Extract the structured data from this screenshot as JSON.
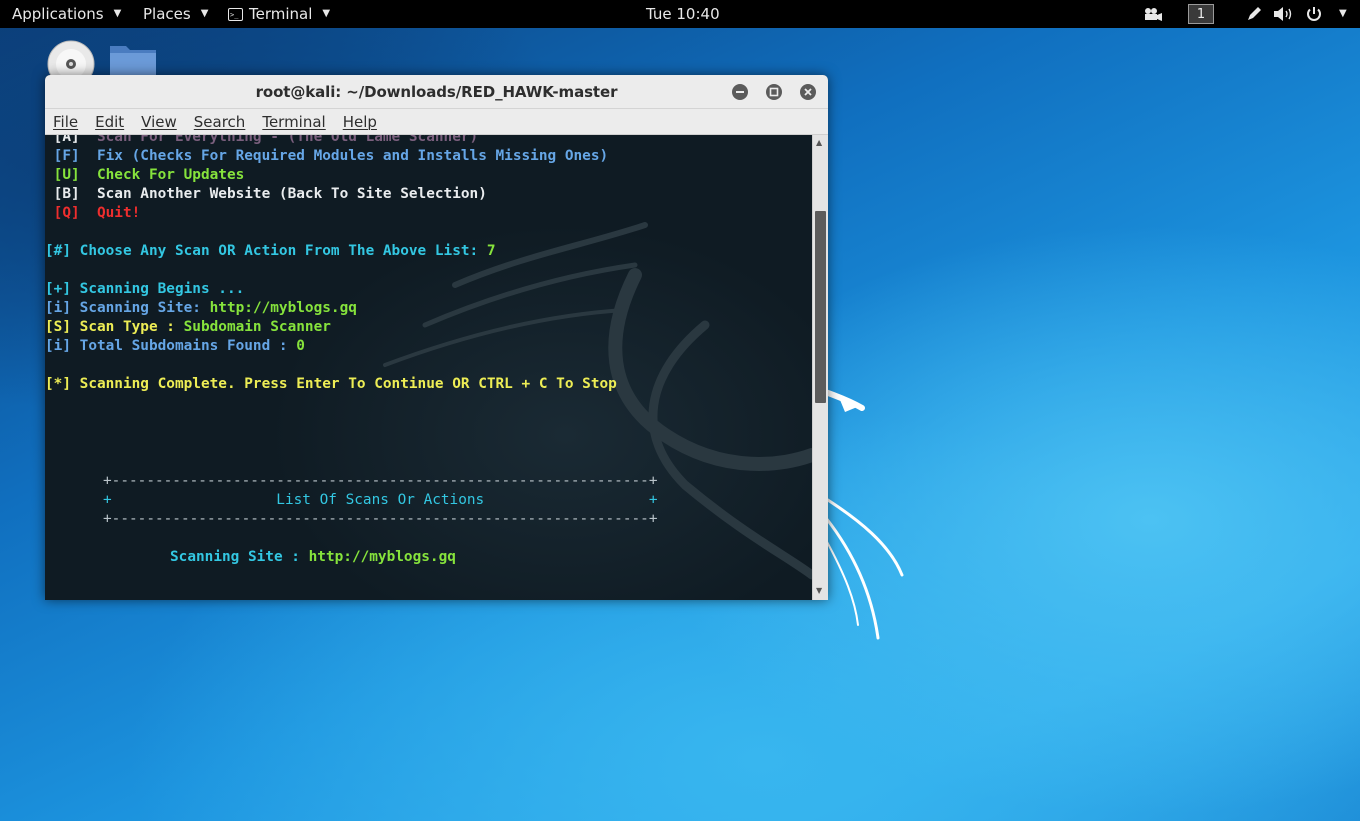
{
  "topbar": {
    "applications": "Applications",
    "places": "Places",
    "terminal": "Terminal",
    "clock": "Tue 10:40",
    "workspace": "1"
  },
  "window": {
    "title": "root@kali: ~/Downloads/RED_HAWK-master",
    "menu": [
      "File",
      "Edit",
      "View",
      "Search",
      "Terminal",
      "Help"
    ]
  },
  "terminal": {
    "lines": [
      {
        "key": " [A]",
        "text": "Scan For Everything - (The Old Lame Scanner)",
        "color": "dim"
      },
      {
        "key": " [F]",
        "text": "Fix (Checks For Required Modules and Installs Missing Ones)",
        "color": "lblue"
      },
      {
        "key": " [U]",
        "text": "Check For Updates",
        "color": "green"
      },
      {
        "key": " [B]",
        "text": "Scan Another Website (Back To Site Selection)",
        "color": "white"
      },
      {
        "key": " [Q]",
        "text": "Quit!",
        "color": "red"
      },
      {
        "prompt": "[#] Choose Any Scan OR Action From The Above List: ",
        "answer": "7"
      },
      {
        "text": "[+] Scanning Begins ..."
      },
      {
        "label": "[i] Scanning Site: ",
        "value": "http://myblogs.gq"
      },
      {
        "label": "[S] Scan Type : ",
        "value": "Subdomain Scanner"
      },
      {
        "label": "[i] Total Subdomains Found : ",
        "value": "0"
      },
      {
        "text": "[*] Scanning Complete. Press Enter To Continue OR CTRL + C To Stop"
      }
    ],
    "box_border": "+--------------------------------------------------------------+",
    "box_title": "+                   List Of Scans Or Actions                   +",
    "footer_label": "Scanning Site : ",
    "footer_value": "http://myblogs.gq"
  }
}
